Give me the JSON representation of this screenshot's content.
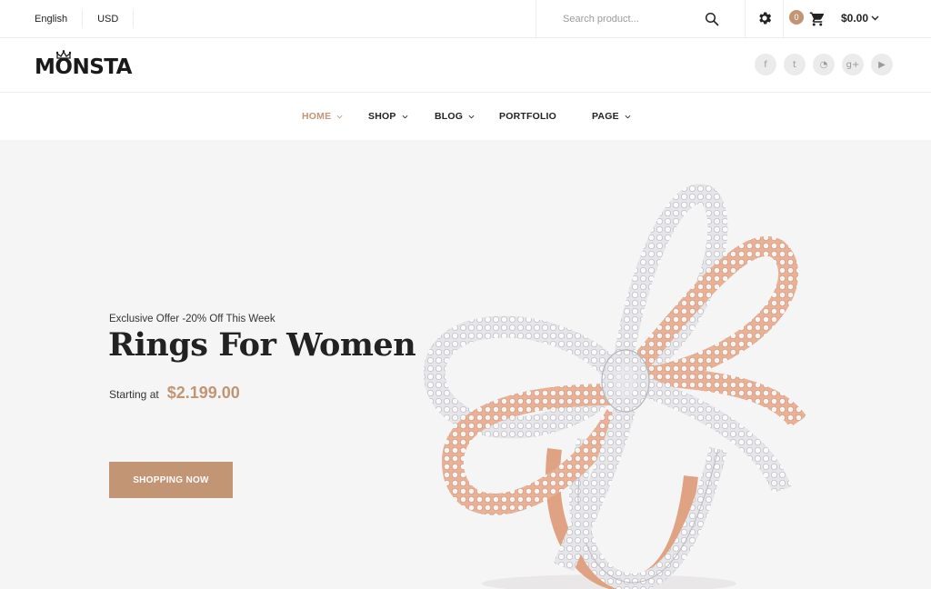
{
  "topbar": {
    "language": "English",
    "currency": "USD",
    "search_placeholder": "Search product...",
    "cart_count": "0",
    "cart_total": "$0.00"
  },
  "brand": {
    "logo_text": "MONSTA"
  },
  "social": [
    {
      "icon": "facebook-icon",
      "glyph": "f"
    },
    {
      "icon": "twitter-icon",
      "glyph": "t"
    },
    {
      "icon": "rss-icon",
      "glyph": "◔"
    },
    {
      "icon": "google-plus-icon",
      "glyph": "g+"
    },
    {
      "icon": "youtube-icon",
      "glyph": "▶"
    }
  ],
  "nav": {
    "home": "HOME",
    "shop": "SHOP",
    "blog": "BLOG",
    "portfolio": "PORTFOLIO",
    "page": "PAGE"
  },
  "hero": {
    "offer": "Exclusive Offer -20% Off This Week",
    "title": "Rings For Women",
    "price_label": "Starting at",
    "price": "$2.199.00",
    "cta": "SHOPPING NOW"
  },
  "colors": {
    "accent": "#c29574",
    "hero_bg": "#f6f5f5",
    "rose_gold": "#e4a785",
    "silver": "#d9d9dc"
  }
}
